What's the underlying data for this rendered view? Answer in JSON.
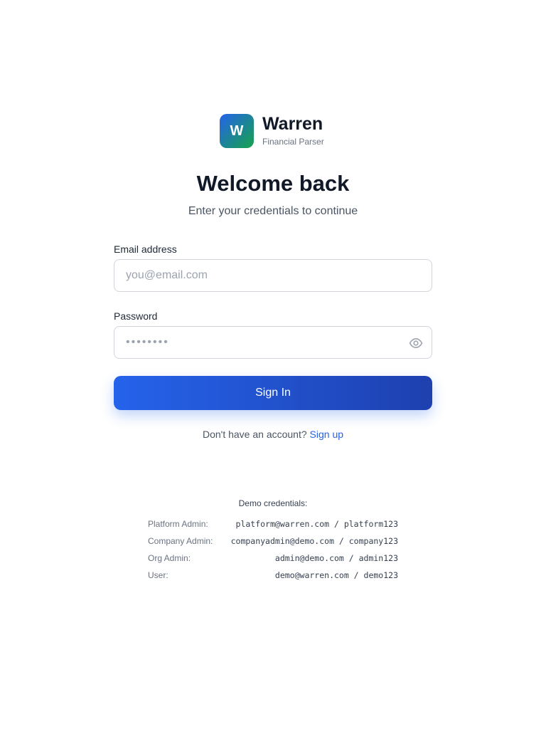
{
  "brand": {
    "logo_letter": "W",
    "name": "Warren",
    "subtitle": "Financial Parser",
    "logo_gradient": [
      "#2563eb",
      "#16a34a"
    ]
  },
  "heading": {
    "title": "Welcome back",
    "subtitle": "Enter your credentials to continue"
  },
  "form": {
    "email": {
      "label": "Email address",
      "placeholder": "you@email.com",
      "value": ""
    },
    "password": {
      "label": "Password",
      "placeholder": "••••••••",
      "value": "",
      "toggle_icon": "eye-icon"
    },
    "submit_label": "Sign In"
  },
  "signup": {
    "prompt": "Don't have an account?",
    "link_label": "Sign up"
  },
  "demo": {
    "title": "Demo credentials:",
    "rows": [
      {
        "role": "Platform Admin:",
        "credentials": "platform@warren.com / platform123"
      },
      {
        "role": "Company Admin:",
        "credentials": "companyadmin@demo.com / company123"
      },
      {
        "role": "Org Admin:",
        "credentials": "admin@demo.com / admin123"
      },
      {
        "role": "User:",
        "credentials": "demo@warren.com / demo123"
      }
    ]
  },
  "colors": {
    "accent": "#2563eb",
    "accent_dark": "#1e40af",
    "text_primary": "#111827",
    "text_muted": "#6b7280"
  }
}
